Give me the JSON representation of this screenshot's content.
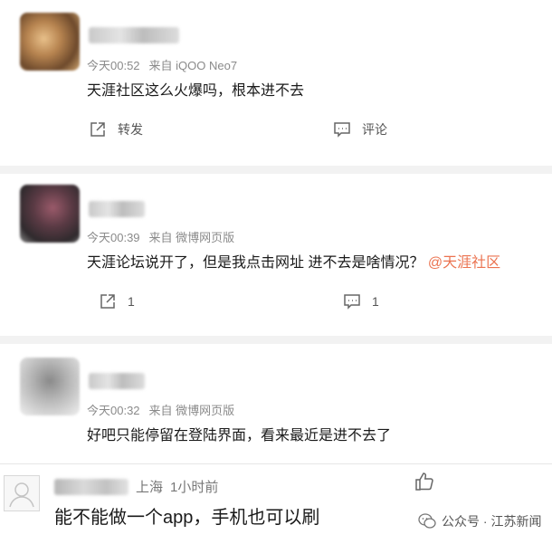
{
  "posts": [
    {
      "time": "今天00:52",
      "source": "来自 iQOO Neo7",
      "text": "天涯社区这么火爆吗，根本进不去",
      "repost_label": "转发",
      "comment_label": "评论"
    },
    {
      "time": "今天00:39",
      "source": "来自 微博网页版",
      "text": "天涯论坛说开了，但是我点击网址 进不去是啥情况？",
      "mention": "@天涯社区",
      "repost_count": "1",
      "comment_count": "1"
    },
    {
      "time": "今天00:32",
      "source": "来自 微博网页版",
      "text": "好吧只能停留在登陆界面，看来最近是进不去了"
    }
  ],
  "reply": {
    "location": "上海",
    "time": "1小时前",
    "text": "能不能做一个app，手机也可以刷"
  },
  "watermark": {
    "text": "公众号 · 江苏新闻"
  },
  "icons": {
    "repost": "share-out-icon",
    "comment": "comment-bubble-icon",
    "like": "thumbs-up-icon",
    "watermark": "wechat-icon"
  },
  "colors": {
    "mention": "#eb7350",
    "meta": "#8a8a8a",
    "separator": "#f2f2f2"
  }
}
